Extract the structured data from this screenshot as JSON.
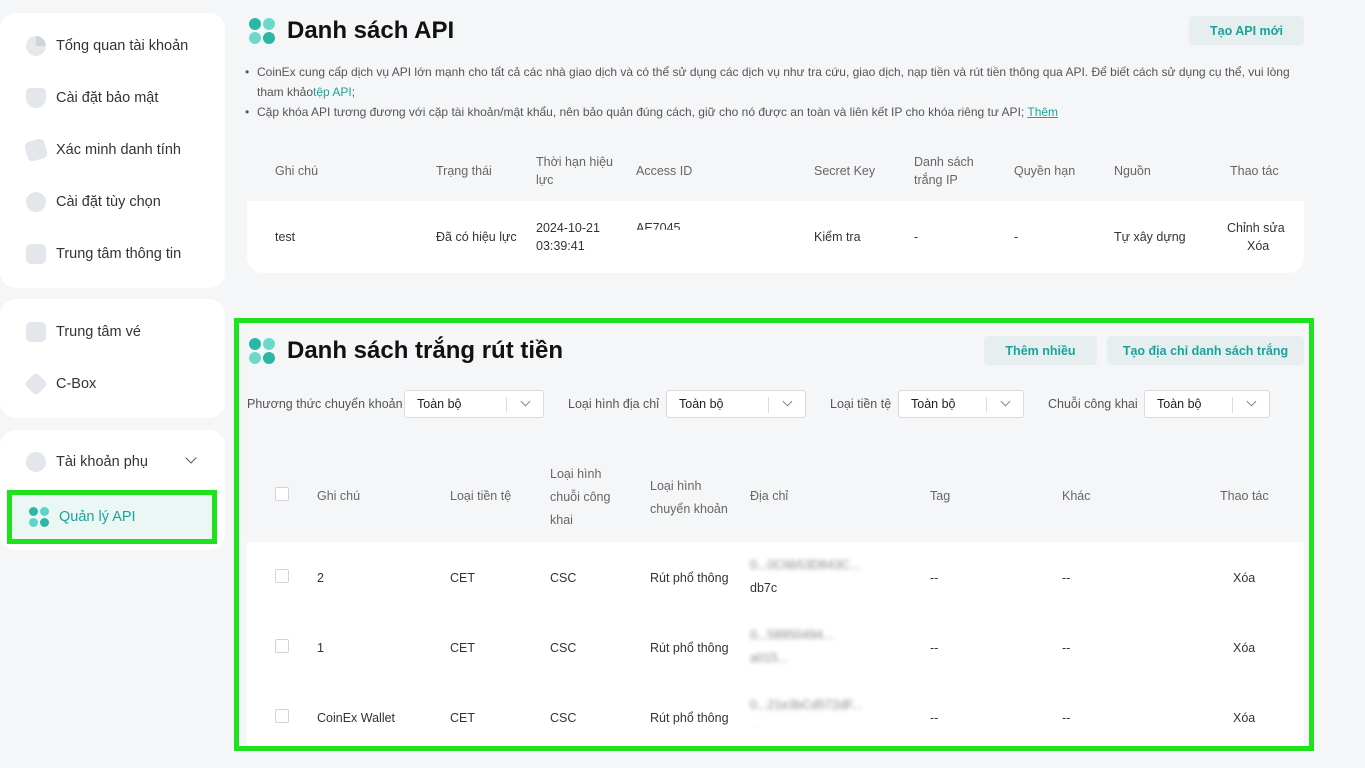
{
  "sidebar": {
    "group1": [
      {
        "label": "Tổng quan tài khoản",
        "icon": "pie-chart-icon"
      },
      {
        "label": "Cài đặt bảo mật",
        "icon": "shield-icon"
      },
      {
        "label": "Xác minh danh tính",
        "icon": "id-badge-icon"
      },
      {
        "label": "Cài đặt tùy chọn",
        "icon": "settings-icon"
      },
      {
        "label": "Trung tâm thông tin",
        "icon": "message-icon"
      }
    ],
    "group2": [
      {
        "label": "Trung tâm vé",
        "icon": "ticket-icon"
      },
      {
        "label": "C-Box",
        "icon": "box-icon"
      }
    ],
    "group3": [
      {
        "label": "Tài khoản phụ",
        "icon": "sub-account-icon"
      }
    ],
    "active": {
      "label": "Quản lý API",
      "icon": "api-logo-icon"
    }
  },
  "api_section": {
    "title": "Danh sách API",
    "create_button": "Tạo API mới",
    "note1_text": "CoinEx cung cấp dịch vụ API lớn mạnh cho tất cả các nhà giao dịch và có thể sử dụng các dịch vụ như tra cứu, giao dịch, nạp tiền và rút tiền thông qua API. Để biết cách sử dụng cụ thể, vui lòng tham khảo",
    "note1_link": "tệp API",
    "note1_end": ";",
    "note2_text": "Cặp khóa API tương đương với cặp tài khoản/mật khẩu, nên bảo quản đúng cách, giữ cho nó được an toàn và liên kết IP cho khóa riêng tư API; ",
    "note2_link": "Thêm",
    "headers": {
      "note": "Ghi chú",
      "status": "Trạng thái",
      "expiry": "Thời hạn hiệu lực",
      "access_id": "Access ID",
      "secret_key": "Secret Key",
      "ip_whitelist": "Danh sách trắng IP",
      "permission": "Quyền hạn",
      "source": "Nguồn",
      "action": "Thao tác"
    },
    "row": {
      "note": "test",
      "status": "Đã có hiệu lực",
      "expiry_date": "2024-10-21",
      "expiry_time": "03:39:41",
      "access_id": "AE7045",
      "secret_key": "Kiểm tra",
      "ip_whitelist": "-",
      "permission": "-",
      "source": "Tự xây dựng",
      "edit": "Chỉnh sửa",
      "delete": "Xóa"
    }
  },
  "whitelist_section": {
    "title": "Danh sách trắng rút tiền",
    "add_many_button": "Thêm nhiều",
    "create_button": "Tạo địa chỉ danh sách trắng",
    "filters": [
      {
        "label": "Phương thức chuyển khoản",
        "value": "Toàn bộ"
      },
      {
        "label": "Loại hình địa chỉ",
        "value": "Toàn bộ"
      },
      {
        "label": "Loại tiền tệ",
        "value": "Toàn bộ"
      },
      {
        "label": "Chuỗi công khai",
        "value": "Toàn bộ"
      }
    ],
    "headers": {
      "note": "Ghi chú",
      "coin": "Loại tiền tệ",
      "chain_l1": "Loại hình",
      "chain_l2": "chuỗi công",
      "chain_l3": "khai",
      "transfer_l1": "Loại hình",
      "transfer_l2": "chuyển khoản",
      "address": "Địa chỉ",
      "tag": "Tag",
      "other": "Khác",
      "action": "Thao tác"
    },
    "rows": [
      {
        "note": "2",
        "coin": "CET",
        "chain": "CSC",
        "transfer": "Rút phổ thông",
        "addr1": "0...0C6b53D843C...",
        "addr2": "db7c",
        "tag": "--",
        "other": "--",
        "action": "Xóa"
      },
      {
        "note": "1",
        "coin": "CET",
        "chain": "CSC",
        "transfer": "Rút phổ thông",
        "addr1": "0...58950494...",
        "addr2": "a015...",
        "tag": "--",
        "other": "--",
        "action": "Xóa"
      },
      {
        "note": "CoinEx Wallet",
        "coin": "CET",
        "chain": "CSC",
        "transfer": "Rút phổ thông",
        "addr1": "0...21e3bCd572dF...",
        "addr2": "...",
        "tag": "--",
        "other": "--",
        "action": "Xóa"
      }
    ]
  },
  "colors": {
    "accent": "#1aa39a",
    "highlight": "#1de21d",
    "background": "#f5f6f8"
  }
}
